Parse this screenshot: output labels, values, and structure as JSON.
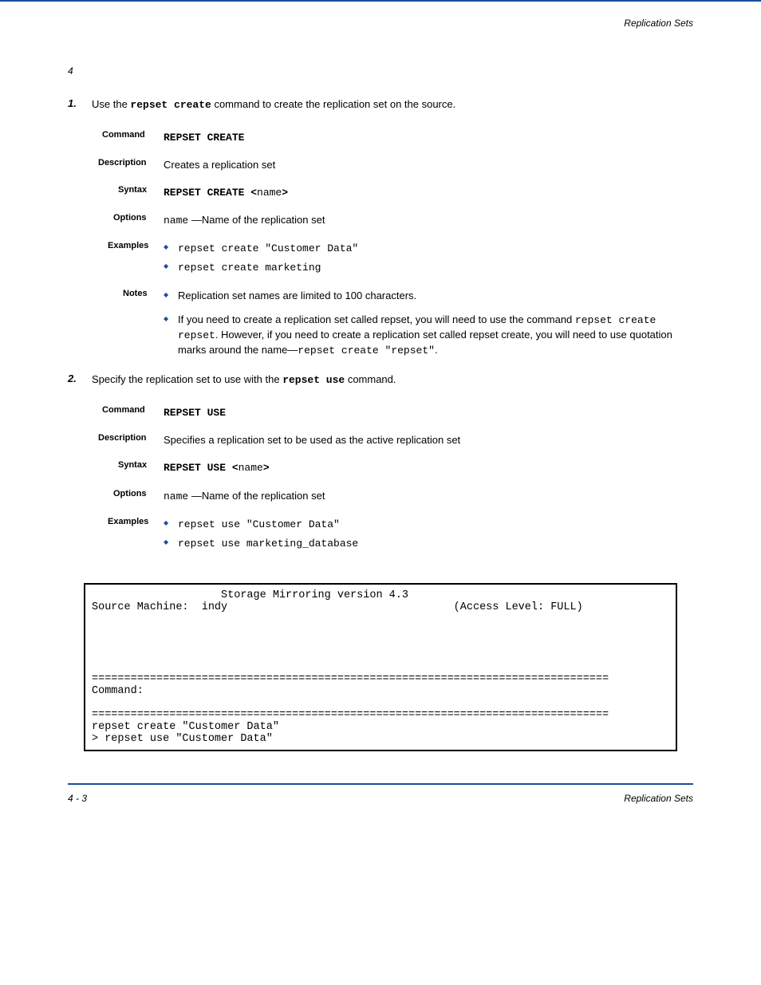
{
  "header": {
    "chapter": "Replication Sets"
  },
  "page_number_text": "4",
  "step1": {
    "number": "1.",
    "text_before": "Use the ",
    "cmd": "repset create",
    "text_after": " command to create the replication set on the source."
  },
  "cmd_create": {
    "label": "Command",
    "command": "REPSET CREATE",
    "desc_label": "Description",
    "desc": "Creates a replication set",
    "syntax_label": "Syntax",
    "syntax_prefix": "REPSET CREATE <",
    "syntax_arg": "name",
    "syntax_suffix": ">",
    "options_label": "Options",
    "options_arg": "name",
    "options_text": " —Name of the replication set",
    "examples_label": "Examples",
    "example1": "repset create \"Customer Data\"",
    "example2": "repset create marketing",
    "notes_label": "Notes",
    "note1": "Replication set names are limited to 100 characters.",
    "note2_a": "If you need to create a replication set called repset, you will need to use the command ",
    "note2_cmd1": "repset create repset",
    "note2_b": ". However, if you need to create a replication set called repset create, you will need to use quotation marks around the name—",
    "note2_cmd2": "repset create \"repset\"",
    "note2_c": "."
  },
  "step2": {
    "number": "2.",
    "text_before": "Specify the replication set to use with the ",
    "cmd": "repset use",
    "text_after": " command."
  },
  "cmd_use": {
    "label": "Command",
    "command": "REPSET USE",
    "desc_label": "Description",
    "desc": "Specifies a replication set to be used as the active replication set",
    "syntax_label": "Syntax",
    "syntax_prefix": "REPSET USE <",
    "syntax_arg": "name",
    "syntax_suffix": ">",
    "options_label": "Options",
    "options_arg": "name",
    "options_text": " —Name of the replication set",
    "examples_label": "Examples",
    "example1": "repset use \"Customer Data\"",
    "example2": "repset use marketing_database"
  },
  "terminal": {
    "title_line": "                    Storage Mirroring version 4.3",
    "source_line": "Source Machine:  indy                                   (Access Level: FULL)",
    "blank": " ",
    "divider": "================================================================================",
    "command_label": "Command:",
    "output1": "repset create \"Customer Data\"",
    "output2": "> repset use \"Customer Data\""
  },
  "footer": {
    "left": "4 - 3",
    "right": "Replication Sets"
  }
}
